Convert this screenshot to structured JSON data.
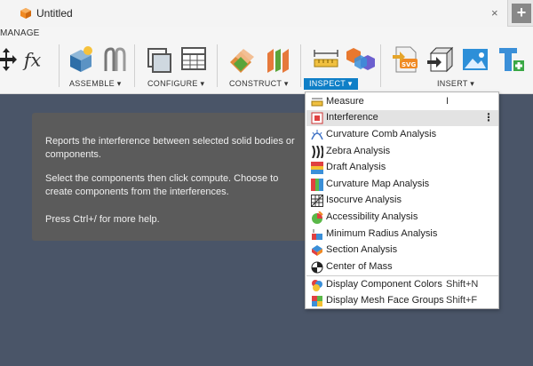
{
  "window": {
    "tab_title": "Untitled",
    "close_glyph": "×",
    "new_tab_glyph": "+"
  },
  "toolbar": {
    "manage_label": "MANAGE",
    "fx_glyph": "fx",
    "groups": {
      "assemble": "ASSEMBLE ▾",
      "configure": "CONFIGURE ▾",
      "construct": "CONSTRUCT ▾",
      "inspect": "INSPECT ▾",
      "insert": "INSERT ▾"
    }
  },
  "tooltip": {
    "line1": "Reports the interference between selected solid bodies or components.",
    "line2": "Select the components then click compute. Choose to create components from the interferences.",
    "line3": "Press Ctrl+/ for more help."
  },
  "inspect_menu": {
    "items": [
      {
        "label": "Measure",
        "shortcut": "I",
        "icon": "ruler-icon"
      },
      {
        "label": "Interference",
        "shortcut": "",
        "icon": "interference-icon",
        "more": "⋮"
      },
      {
        "label": "Curvature Comb Analysis",
        "shortcut": "",
        "icon": "curvature-comb-icon"
      },
      {
        "label": "Zebra Analysis",
        "shortcut": "",
        "icon": "zebra-icon"
      },
      {
        "label": "Draft Analysis",
        "shortcut": "",
        "icon": "draft-icon"
      },
      {
        "label": "Curvature Map Analysis",
        "shortcut": "",
        "icon": "curvature-map-icon"
      },
      {
        "label": "Isocurve Analysis",
        "shortcut": "",
        "icon": "isocurve-icon"
      },
      {
        "label": "Accessibility Analysis",
        "shortcut": "",
        "icon": "accessibility-icon"
      },
      {
        "label": "Minimum Radius Analysis",
        "shortcut": "",
        "icon": "minimum-radius-icon"
      },
      {
        "label": "Section Analysis",
        "shortcut": "",
        "icon": "section-icon"
      },
      {
        "label": "Center of Mass",
        "shortcut": "",
        "icon": "center-of-mass-icon"
      },
      {
        "label": "Display Component Colors",
        "shortcut": "Shift+N",
        "icon": "component-colors-icon"
      },
      {
        "label": "Display Mesh Face Groups",
        "shortcut": "Shift+F",
        "icon": "mesh-face-groups-icon"
      }
    ]
  },
  "colors": {
    "accent": "#0f7fc7",
    "canvas": "#4a5568",
    "tooltip_bg": "#5b5b5b",
    "highlight": "#e3e3e3"
  }
}
